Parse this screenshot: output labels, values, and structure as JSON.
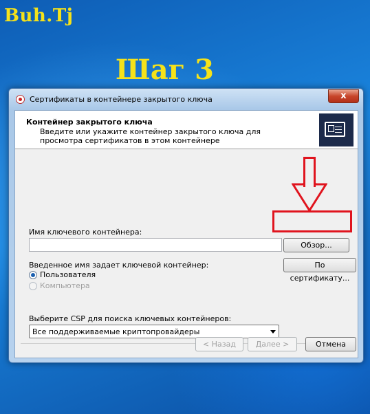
{
  "overlay": {
    "brand": "Buh.Tj",
    "step": "Шаг 3",
    "accent_color": "#f5e21a",
    "highlight_color": "#e0141e"
  },
  "window": {
    "title": "Сертификаты в контейнере закрытого ключа",
    "close_label": "x",
    "header": {
      "title": "Контейнер закрытого ключа",
      "description": "Введите или укажите контейнер закрытого ключа для просмотра сертификатов в этом контейнере",
      "icon": "certificate-icon"
    },
    "container_name": {
      "label": "Имя ключевого контейнера:",
      "value": "",
      "browse_label": "Обзор..."
    },
    "by_certificate_label": "По сертификату...",
    "key_scope": {
      "label": "Введенное имя задает ключевой контейнер:",
      "options": [
        {
          "label": "Пользователя",
          "checked": true,
          "disabled": false
        },
        {
          "label": "Компьютера",
          "checked": false,
          "disabled": true
        }
      ]
    },
    "csp": {
      "label": "Выберите CSP для поиска ключевых контейнеров:",
      "selected": "Все поддерживаемые криптопровайдеры"
    },
    "footer": {
      "back_label": "< Назад",
      "next_label": "Далее >",
      "cancel_label": "Отмена"
    }
  }
}
